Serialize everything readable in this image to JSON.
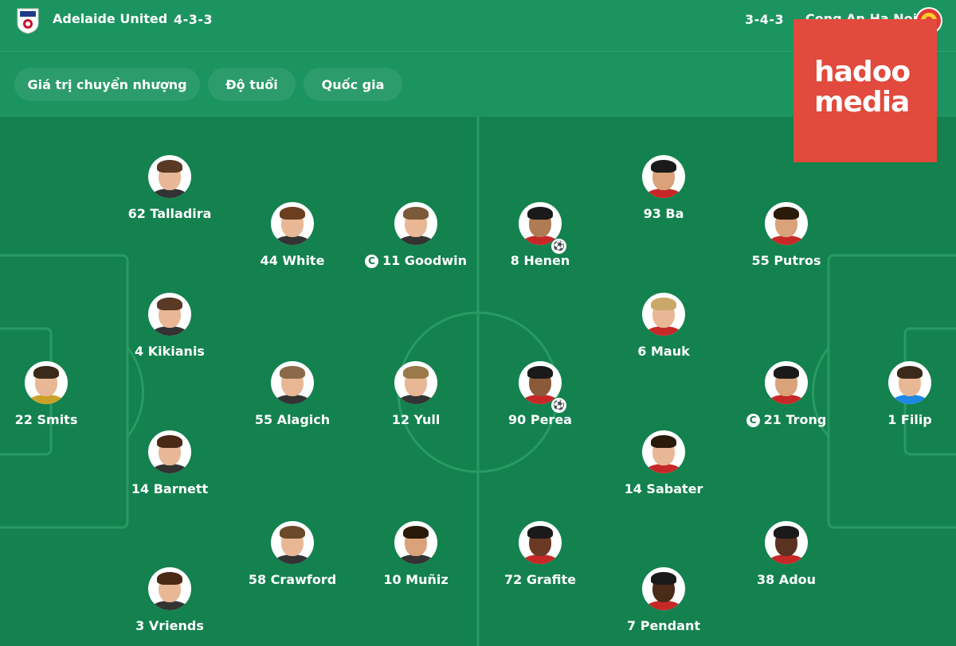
{
  "header": {
    "home_team": "Adelaide United",
    "home_formation": "4-3-3",
    "away_formation": "3-4-3",
    "away_team": "Cong An Ha Noi",
    "home_logo_icon": "adelaide-united-crest-icon",
    "away_logo_icon": "cong-an-ha-noi-crest-icon"
  },
  "filters": [
    {
      "label": "Giá trị chuyển nhượng"
    },
    {
      "label": "Độ tuổi"
    },
    {
      "label": "Quốc gia"
    }
  ],
  "watermark": {
    "line1": "hadoo",
    "line2": "media"
  },
  "captain_badge": "C",
  "home_players": [
    {
      "label": "62 Talladira"
    },
    {
      "label": "44 White"
    },
    {
      "label": "11 Goodwin",
      "captain": true
    },
    {
      "label": "4 Kikianis"
    },
    {
      "label": "22 Smits"
    },
    {
      "label": "55 Alagich"
    },
    {
      "label": "12 Yull"
    },
    {
      "label": "14 Barnett"
    },
    {
      "label": "58 Crawford"
    },
    {
      "label": "10 Muñiz"
    },
    {
      "label": "3 Vriends"
    }
  ],
  "away_players": [
    {
      "label": "93 Ba"
    },
    {
      "label": "8 Henen",
      "goal": true
    },
    {
      "label": "55 Putros"
    },
    {
      "label": "6 Mauk"
    },
    {
      "label": "90 Perea",
      "goal": true
    },
    {
      "label": "21 Trong",
      "captain": true
    },
    {
      "label": "1 Filip"
    },
    {
      "label": "14 Sabater"
    },
    {
      "label": "72 Grafite"
    },
    {
      "label": "38 Adou"
    },
    {
      "label": "7 Pendant"
    }
  ],
  "colors": {
    "pitch": "#13824f",
    "bar": "#1b9460",
    "watermark": "#e14a3c"
  }
}
